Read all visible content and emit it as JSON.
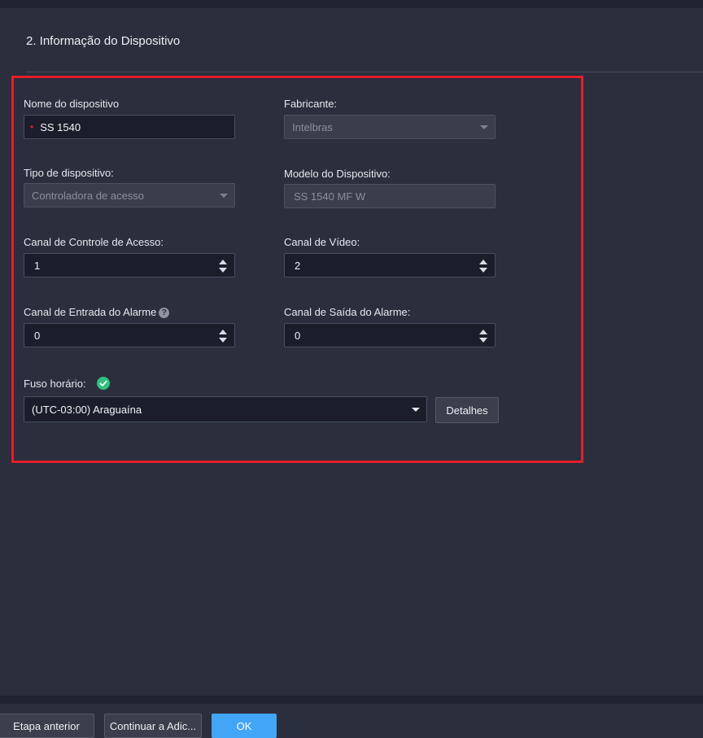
{
  "section": {
    "title": "2. Informação do Dispositivo"
  },
  "form": {
    "device_name": {
      "label": "Nome do dispositivo",
      "value": "SS 1540",
      "required": true
    },
    "manufacturer": {
      "label": "Fabricante:",
      "value": "Intelbras"
    },
    "device_type": {
      "label": "Tipo de dispositivo:",
      "value": "Controladora de acesso"
    },
    "device_model": {
      "label": "Modelo do Dispositivo:",
      "value": "SS 1540 MF W"
    },
    "access_channel": {
      "label": "Canal de Controle de Acesso:",
      "value": "1"
    },
    "video_channel": {
      "label": "Canal de Vídeo:",
      "value": "2"
    },
    "alarm_in_channel": {
      "label": "Canal de Entrada do Alarme",
      "value": "0",
      "help_icon": "question-circle-icon"
    },
    "alarm_out_channel": {
      "label": "Canal de Saída do Alarme:",
      "value": "0"
    },
    "timezone": {
      "label": "Fuso horário:",
      "value": "(UTC-03:00) Araguaína",
      "status_icon": "check-circle-icon",
      "details_label": "Detalhes"
    }
  },
  "footer": {
    "prev_label": "Etapa anterior",
    "continue_label": "Continuar a Adic...",
    "ok_label": "OK"
  },
  "colors": {
    "background": "#2a2e3d",
    "highlight_border": "#e0202a",
    "primary_button": "#42a5f5",
    "success": "#2ec27e"
  }
}
